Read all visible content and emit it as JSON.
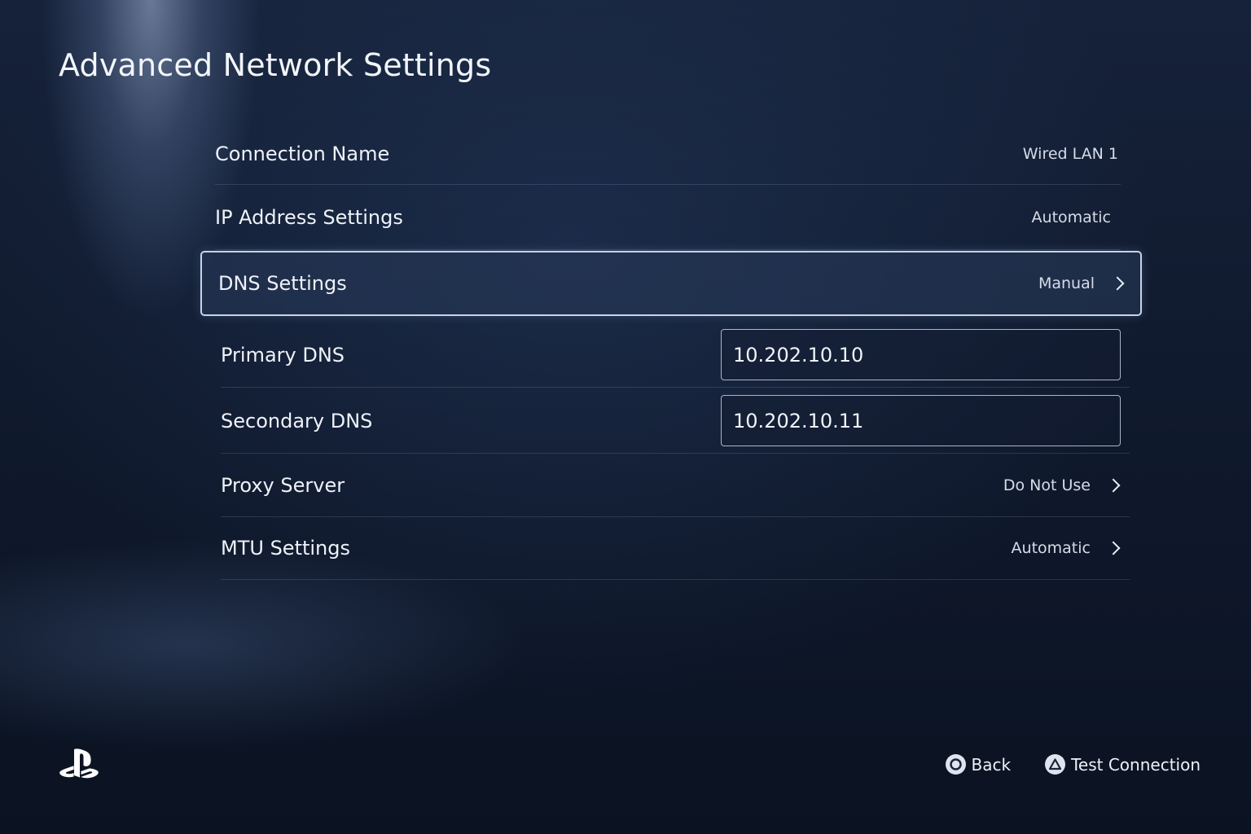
{
  "header": {
    "title": "Advanced Network Settings"
  },
  "settings": {
    "connection_name": {
      "label": "Connection Name",
      "value": "Wired LAN 1"
    },
    "ip_address": {
      "label": "IP Address Settings",
      "value": "Automatic"
    },
    "dns": {
      "label": "DNS Settings",
      "value": "Manual",
      "selected": true
    },
    "primary_dns": {
      "label": "Primary DNS",
      "value": "10.202.10.10"
    },
    "secondary_dns": {
      "label": "Secondary DNS",
      "value": "10.202.10.11"
    },
    "proxy": {
      "label": "Proxy Server",
      "value": "Do Not Use"
    },
    "mtu": {
      "label": "MTU Settings",
      "value": "Automatic"
    }
  },
  "footer": {
    "back": {
      "label": "Back",
      "icon": "circle-button-icon"
    },
    "test": {
      "label": "Test Connection",
      "icon": "triangle-button-icon"
    }
  },
  "brand": {
    "logo": "playstation-logo-icon"
  },
  "colors": {
    "background_top": "#16223a",
    "background_bottom": "#0b1322",
    "selection_border": "#c9d3e4",
    "text": "#eef2f8"
  }
}
